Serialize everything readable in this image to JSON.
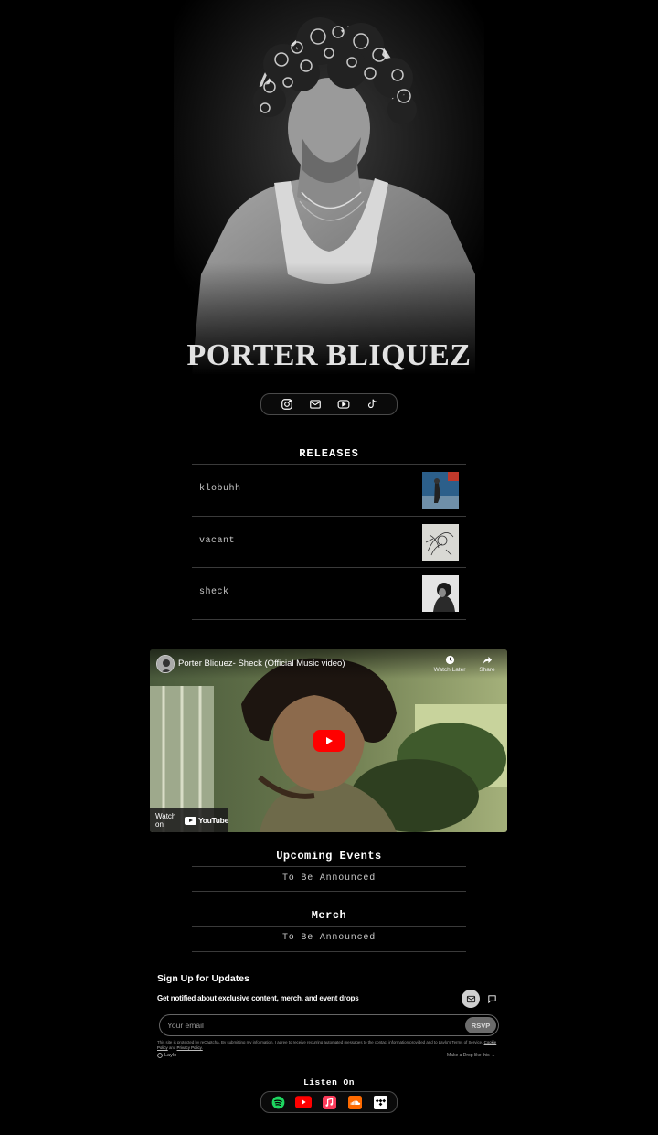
{
  "artist": {
    "name": "PORTER BLIQUEZ"
  },
  "social": [
    {
      "icon": "instagram-icon"
    },
    {
      "icon": "mail-icon"
    },
    {
      "icon": "youtube-icon"
    },
    {
      "icon": "tiktok-icon"
    }
  ],
  "releases": {
    "title": "RELEASES",
    "items": [
      {
        "name": "klobuhh"
      },
      {
        "name": "vacant"
      },
      {
        "name": "sheck"
      }
    ]
  },
  "video": {
    "title": "Porter Bliquez- Sheck (Official Music video)",
    "watch_later": "Watch Later",
    "share": "Share",
    "watch_on": "Watch on",
    "youtube": "YouTube"
  },
  "events": {
    "title": "Upcoming Events",
    "status": "To Be Announced"
  },
  "merch": {
    "title": "Merch",
    "status": "To Be Announced"
  },
  "signup": {
    "title": "Sign Up for Updates",
    "subtitle": "Get notified about exclusive content, merch, and event drops",
    "email_placeholder": "Your email",
    "button": "RSVP",
    "legal_text": "This site is protected by reCaptcha. By submitting my information, I agree to receive recurring automated messages to the contact information provided and to Laylo's Terms of Service,",
    "cookie_policy": "Cookie Policy",
    "and": "and",
    "privacy_policy": "Privacy Policy.",
    "brand": "Laylo",
    "make_drop": "Make a Drop like this →"
  },
  "listen": {
    "title": "Listen On",
    "services": [
      {
        "icon": "spotify-icon",
        "color": "#1ed760"
      },
      {
        "icon": "youtube-icon",
        "color": "#ff0000"
      },
      {
        "icon": "apple-music-icon",
        "color": "#fa3c5a"
      },
      {
        "icon": "soundcloud-icon",
        "color": "#ff6a00"
      },
      {
        "icon": "tidal-icon",
        "color": "#ffffff"
      }
    ]
  }
}
